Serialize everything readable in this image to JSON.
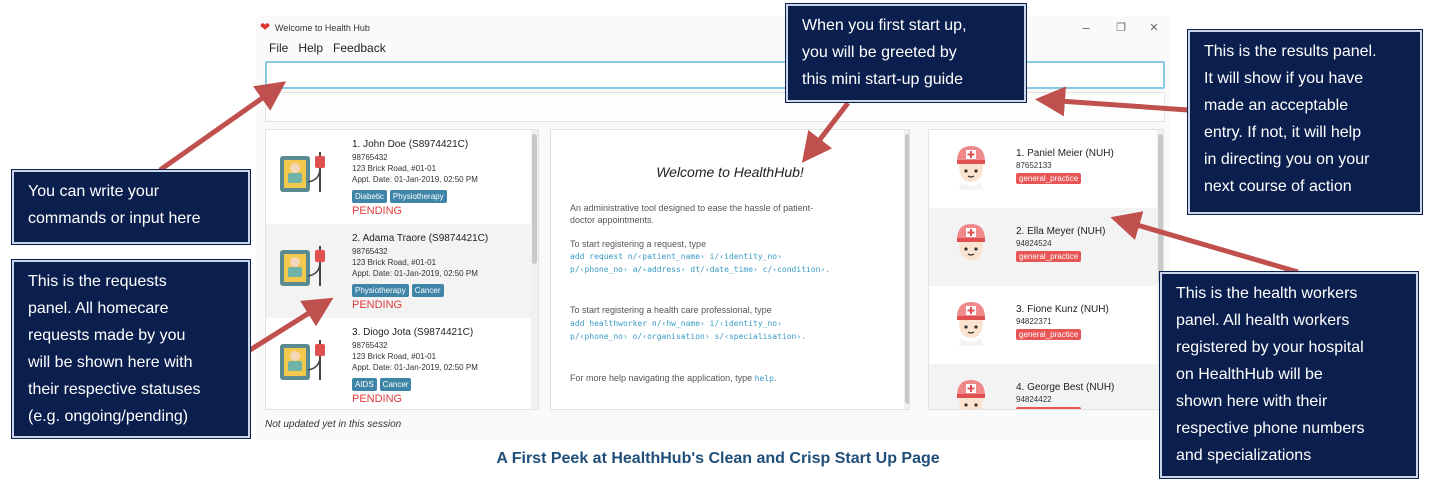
{
  "window": {
    "title": "Welcome to Health Hub",
    "controls": [
      "–",
      "❐",
      "✕"
    ]
  },
  "menu": [
    "File",
    "Help",
    "Feedback"
  ],
  "command_input": {
    "value": "",
    "placeholder": ""
  },
  "requests": [
    {
      "name": "1.  John Doe  (S8974421C)",
      "phone": "98765432",
      "address": "123 Brick Road, #01-01",
      "appt": "Appt. Date: 01-Jan-2019, 02:50 PM",
      "tags": [
        "Diabetic",
        "Physiotherapy"
      ],
      "status": "PENDING"
    },
    {
      "name": "2.  Adama Traore  (S9874421C)",
      "phone": "98765432",
      "address": "123 Brick Road, #01-01",
      "appt": "Appt. Date: 01-Jan-2019, 02:50 PM",
      "tags": [
        "Physiotherapy",
        "Cancer"
      ],
      "status": "PENDING"
    },
    {
      "name": "3.  Diogo Jota  (S9874421C)",
      "phone": "98765432",
      "address": "123 Brick Road, #01-01",
      "appt": "Appt. Date: 01-Jan-2019, 02:50 PM",
      "tags": [
        "AIDS",
        "Cancer"
      ],
      "status": "PENDING"
    }
  ],
  "welcome": {
    "title": "Welcome to HealthHub!",
    "intro_1": "An administrative tool designed to ease the hassle of patient-",
    "intro_2": "doctor appointments.",
    "request_label": "To start registering a request, type",
    "request_cmd_1": "add request n/‹patient_name› i/‹identity_no›",
    "request_cmd_2": "p/‹phone_no› a/‹address› dt/‹date_time› c/‹condition›.",
    "hw_label": "To start registering a health care professional, type",
    "hw_cmd_1": "add healthworker n/‹hw_name› i/‹identity_no›",
    "hw_cmd_2": "p/‹phone_no› o/‹organisation› s/‹specialisation›.",
    "help_label": "For more help navigating the application, type",
    "help_cmd": "help"
  },
  "health_workers": [
    {
      "name": "1.  Paniel Meier  (NUH)",
      "phone": "87652133",
      "spec": "general_practice"
    },
    {
      "name": "2.  Ella Meyer  (NUH)",
      "phone": "94824524",
      "spec": "general_practice"
    },
    {
      "name": "3.  Fione Kunz  (NUH)",
      "phone": "94822371",
      "spec": "general_practice"
    },
    {
      "name": "4.  George Best  (NUH)",
      "phone": "94824422",
      "spec": "general_practice"
    }
  ],
  "status_bar": "Not updated yet in this session",
  "annotations": {
    "input": [
      "You can write your",
      "commands or input here"
    ],
    "requests": [
      "This is the requests",
      "panel. All homecare",
      "requests made by you",
      "will be shown here with",
      "their respective statuses",
      "(e.g. ongoing/pending)"
    ],
    "startup": [
      "When you first start up,",
      "you will be greeted by",
      "this mini start-up guide"
    ],
    "results": [
      "This is the results panel.",
      "It will show if you have",
      "made an acceptable",
      "entry. If not, it will help",
      "in directing you on your",
      "next course of action"
    ],
    "workers": [
      "This is the health workers",
      "panel. All health workers",
      "registered by your hospital",
      "on HealthHub will be",
      "shown here with their",
      "respective phone numbers",
      "and specializations"
    ]
  },
  "caption": "A First Peek at HealthHub's Clean and Crisp Start Up Page",
  "colors": {
    "callout_bg": "#0b1f4e",
    "arrow": "#c0504d",
    "tag": "#3f85a8",
    "spec_tag": "#e85555",
    "pending": "#e03b3b",
    "input_border": "#87c8e6",
    "caption": "#1f4e79"
  }
}
